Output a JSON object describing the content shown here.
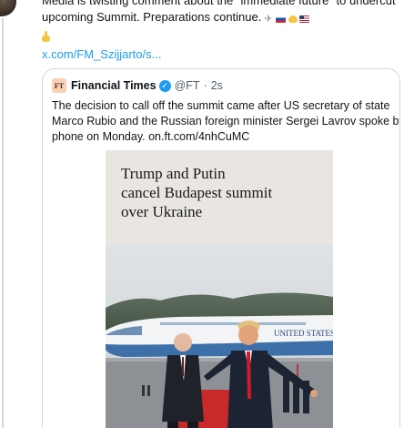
{
  "tweet": {
    "lines": [
      "Media is twisting comment about the \"immediate future\" to undercut the",
      "upcoming Summit. Preparations continue."
    ],
    "link_text": "x.com/FM_Szijjarto/s..."
  },
  "quote": {
    "account_name": "Financial Times",
    "logo_text": "FT",
    "handle": "@FT",
    "separator": "·",
    "time": "2s",
    "text_lines": [
      "The decision to call off the summit came after US secretary of state",
      "Marco Rubio and the Russian foreign minister Sergei Lavrov spoke by",
      "phone on Monday. on.ft.com/4nhCuMC"
    ]
  },
  "article": {
    "headline_lines": [
      "Trump and Putin",
      "cancel Budapest summit",
      "over Ukraine"
    ],
    "plane_lettering": "UNITED STATES"
  },
  "icons": [
    "airplane-emoji",
    "russia-flag-emoji",
    "hand-emoji",
    "us-flag-emoji",
    "pointing-down-emoji",
    "verified-badge-icon"
  ],
  "colors": {
    "link": "#1d9bf0",
    "secondary_text": "#536471",
    "border": "#cfd9de",
    "ft_logo_bg": "#fcd0b1",
    "article_bg": "#e9e6e1"
  }
}
